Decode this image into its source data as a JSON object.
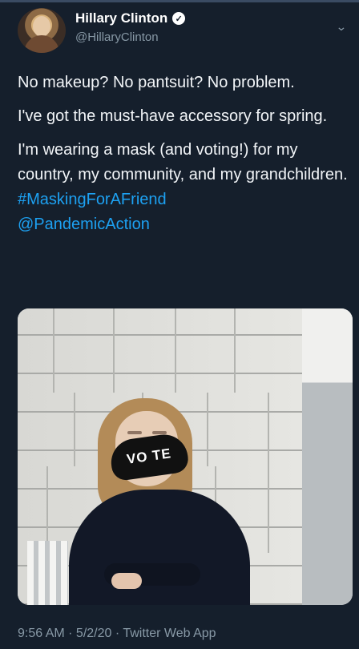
{
  "tweet": {
    "name": "Hillary Clinton",
    "handle": "@HillaryClinton",
    "verified_mark": "✓",
    "menu_icon": "⌄",
    "paragraphs": [
      "No makeup? No pantsuit? No problem.",
      "I've got the must-have accessory for spring.",
      "I'm wearing a mask (and voting!) for my country, my community, and my grandchildren."
    ],
    "hashtag": "#MaskingForAFriend",
    "mention": "@PandemicAction",
    "media_text": "VO TE",
    "timestamp": "9:56 AM · 5/2/20 · Twitter Web App"
  },
  "colors": {
    "background": "#151f2c",
    "text": "#f2f5f8",
    "secondary_text": "#8899a6",
    "link": "#1da1f2"
  },
  "icons": {
    "verified": "verified-badge-icon",
    "menu": "chevron-down-icon"
  }
}
